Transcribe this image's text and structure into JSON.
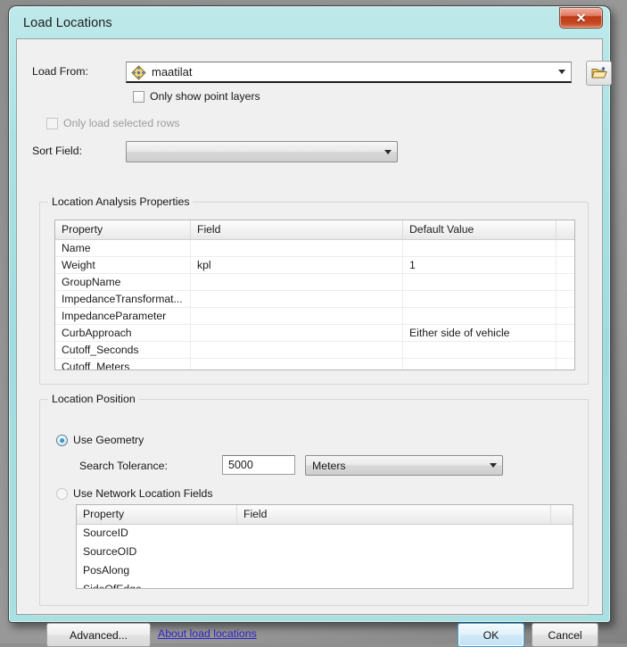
{
  "window": {
    "title": "Load Locations",
    "close_label": "✕",
    "close_icon": "close-icon"
  },
  "load_from": {
    "label": "Load From:",
    "value": "maatilat",
    "layer_icon": "point-layer-icon",
    "browse_icon": "open-folder-icon",
    "dropdown_icon": "chevron-down-icon"
  },
  "checkboxes": {
    "only_show_point_layers": {
      "label": "Only show point layers",
      "checked": false,
      "disabled": false
    },
    "only_load_selected_rows": {
      "label": "Only load selected rows",
      "checked": false,
      "disabled": true
    }
  },
  "sort_field": {
    "label": "Sort Field:",
    "value": "",
    "dropdown_icon": "chevron-down-icon"
  },
  "location_analysis_properties": {
    "legend": "Location Analysis Properties",
    "columns": [
      "Property",
      "Field",
      "Default Value",
      ""
    ],
    "rows": [
      {
        "property": "Name",
        "field": "",
        "default_value": "",
        "extra": ""
      },
      {
        "property": "Weight",
        "field": "kpl",
        "default_value": "1",
        "extra": ""
      },
      {
        "property": "GroupName",
        "field": "",
        "default_value": "",
        "extra": ""
      },
      {
        "property": "ImpedanceTransformat...",
        "field": "",
        "default_value": "",
        "extra": ""
      },
      {
        "property": "ImpedanceParameter",
        "field": "",
        "default_value": "",
        "extra": ""
      },
      {
        "property": "CurbApproach",
        "field": "",
        "default_value": "Either side of vehicle",
        "extra": ""
      },
      {
        "property": "Cutoff_Seconds",
        "field": "",
        "default_value": "",
        "extra": ""
      },
      {
        "property": "Cutoff_Meters",
        "field": "",
        "default_value": "",
        "extra": ""
      }
    ]
  },
  "location_position": {
    "legend": "Location Position",
    "use_geometry": {
      "label": "Use Geometry",
      "selected": true
    },
    "search_tolerance": {
      "label": "Search Tolerance:",
      "value": "5000"
    },
    "units": {
      "value": "Meters",
      "dropdown_icon": "chevron-down-icon"
    },
    "use_network_location_fields": {
      "label": "Use Network Location Fields",
      "selected": false
    },
    "network_grid": {
      "columns": [
        "Property",
        "Field",
        ""
      ],
      "rows": [
        {
          "property": "SourceID",
          "field": "",
          "extra": ""
        },
        {
          "property": "SourceOID",
          "field": "",
          "extra": ""
        },
        {
          "property": "PosAlong",
          "field": "",
          "extra": ""
        },
        {
          "property": "SideOfEdge",
          "field": "",
          "extra": ""
        }
      ]
    }
  },
  "footer": {
    "advanced_label": "Advanced...",
    "help_link": "About load locations",
    "ok_label": "OK",
    "cancel_label": "Cancel"
  },
  "colors": {
    "frame_teal": "#a9e2e4",
    "close_red": "#bf3b17",
    "link_blue": "#2d23c9",
    "ok_focus_blue": "#3c9ad4",
    "client_gray": "#f0f0f0"
  }
}
